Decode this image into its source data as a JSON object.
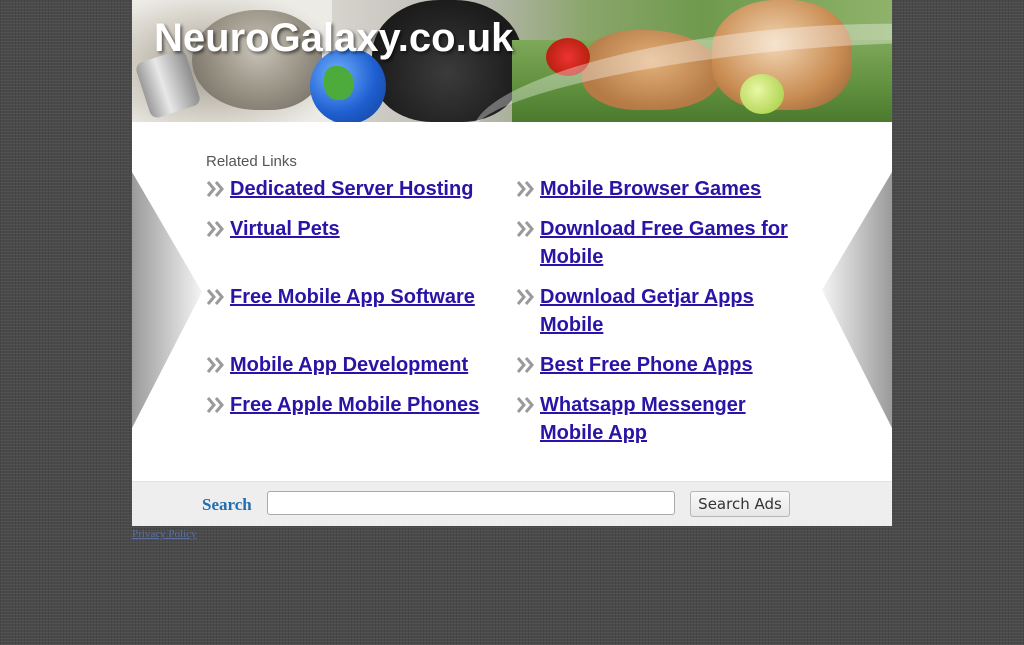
{
  "header": {
    "site_title": "NeuroGalaxy.co.uk"
  },
  "related": {
    "label": "Related Links",
    "left_links": [
      {
        "label": "Dedicated Server Hosting"
      },
      {
        "label": "Virtual Pets"
      },
      {
        "label": "Free Mobile App Software"
      },
      {
        "label": "Mobile App Development"
      },
      {
        "label": "Free Apple Mobile Phones"
      }
    ],
    "right_links": [
      {
        "label": "Mobile Browser Games"
      },
      {
        "label": "Download Free Games for Mobile"
      },
      {
        "label": "Download Getjar Apps Mobile"
      },
      {
        "label": "Best Free Phone Apps"
      },
      {
        "label": "Whatsapp Messenger Mobile App"
      }
    ]
  },
  "search": {
    "label": "Search",
    "input_value": "",
    "button_label": "Search Ads"
  },
  "footer": {
    "privacy_label": "Privacy Policy"
  },
  "colors": {
    "link": "#2a14a6",
    "search_label": "#1f6fb0",
    "background": "#4a4a4a"
  }
}
